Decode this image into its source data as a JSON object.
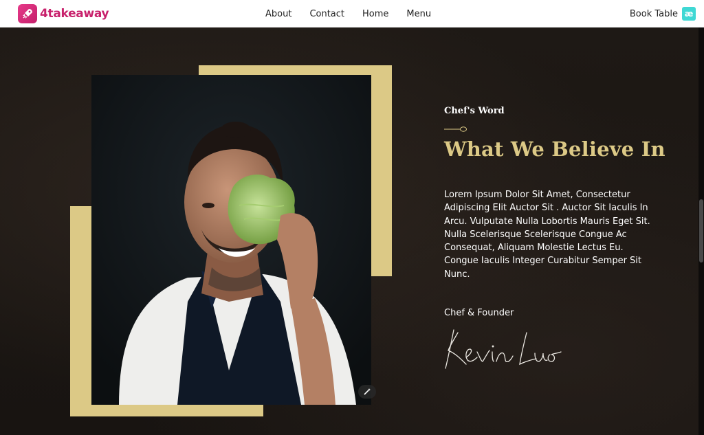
{
  "header": {
    "logo_text": "4takeaway",
    "nav": [
      {
        "label": "About"
      },
      {
        "label": "Contact"
      },
      {
        "label": "Home"
      },
      {
        "label": "Menu"
      }
    ],
    "book_label": "Book Table",
    "book_icon_glyph": "æ"
  },
  "hero": {
    "eyebrow": "Chef's Word",
    "headline": "What We Believe In",
    "body": "Lorem Ipsum Dolor Sit Amet, Consectetur Adipiscing Elit Auctor Sit . Auctor Sit Iaculis In Arcu. Vulputate Nulla Lobortis Mauris Eget Sit. Nulla Scelerisque Scelerisque Congue Ac Consequat, Aliquam Molestie Lectus Eu. Congue Iaculis Integer Curabitur Semper Sit Nunc.",
    "role": "Chef & Founder",
    "signature": "Kevin Luo"
  },
  "colors": {
    "accent_gold": "#dcc986",
    "brand_pink": "#c8216c",
    "background": "#1c1714"
  },
  "icons": [
    "rocket-icon",
    "ae-icon",
    "magic-wand-icon",
    "spoon-divider-icon"
  ]
}
